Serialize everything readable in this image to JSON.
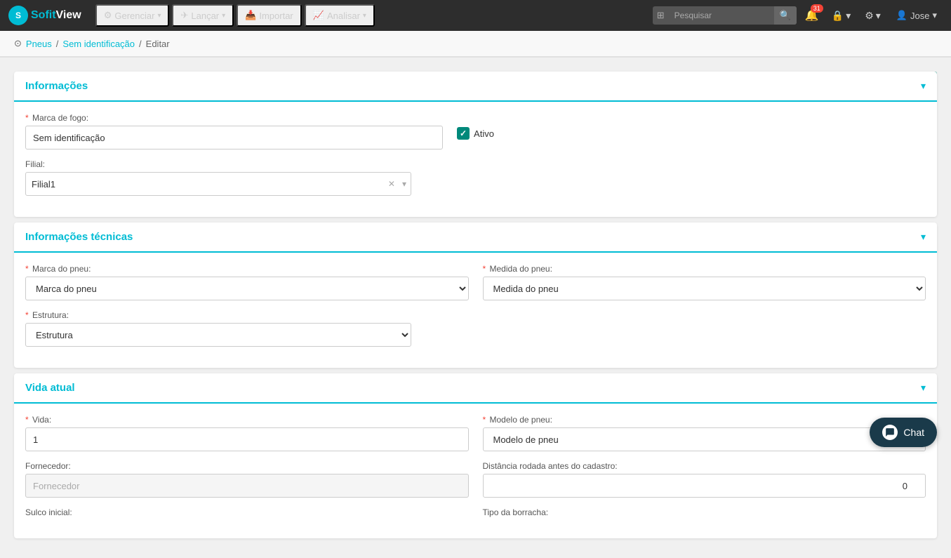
{
  "brand": {
    "logo_text": "S",
    "name_part1": "Sofit",
    "name_part2": "View"
  },
  "nav": {
    "items": [
      {
        "label": "Gerenciar",
        "has_arrow": true,
        "icon": "⚙"
      },
      {
        "label": "Lançar",
        "has_arrow": true,
        "icon": "✈"
      },
      {
        "label": "Importar",
        "has_arrow": false,
        "icon": "📥"
      },
      {
        "label": "Analisar",
        "has_arrow": true,
        "icon": "📈"
      }
    ]
  },
  "search": {
    "placeholder": "Pesquisar"
  },
  "notifications": {
    "count": "31"
  },
  "user": {
    "name": "Jose"
  },
  "breadcrumb": {
    "items": [
      {
        "label": "Pneus",
        "link": true
      },
      {
        "label": "Sem identificação",
        "link": true
      },
      {
        "label": "Editar",
        "link": false
      }
    ],
    "separator": "/"
  },
  "sections": {
    "informacoes": {
      "title": "Informações",
      "fields": {
        "marca_label": "Marca de fogo:",
        "marca_value": "Sem identificação",
        "ativo_label": "Ativo",
        "filial_label": "Filial:",
        "filial_value": "Filial1",
        "filial_placeholder": "Filial1"
      }
    },
    "informacoes_tecnicas": {
      "title": "Informações técnicas",
      "fields": {
        "marca_pneu_label": "Marca do pneu:",
        "marca_pneu_placeholder": "Marca do pneu",
        "medida_label": "Medida do pneu:",
        "medida_placeholder": "Medida do pneu",
        "estrutura_label": "Estrutura:",
        "estrutura_placeholder": "Estrutura"
      }
    },
    "vida_atual": {
      "title": "Vida atual",
      "fields": {
        "vida_label": "Vida:",
        "vida_value": "1",
        "modelo_label": "Modelo de pneu:",
        "modelo_placeholder": "Modelo de pneu",
        "fornecedor_label": "Fornecedor:",
        "fornecedor_placeholder": "Fornecedor",
        "distancia_label": "Distância rodada antes do cadastro:",
        "distancia_value": "0",
        "sulco_label": "Sulco inicial:",
        "tipo_borracha_label": "Tipo da borracha:"
      }
    }
  },
  "chat": {
    "label": "Chat"
  }
}
